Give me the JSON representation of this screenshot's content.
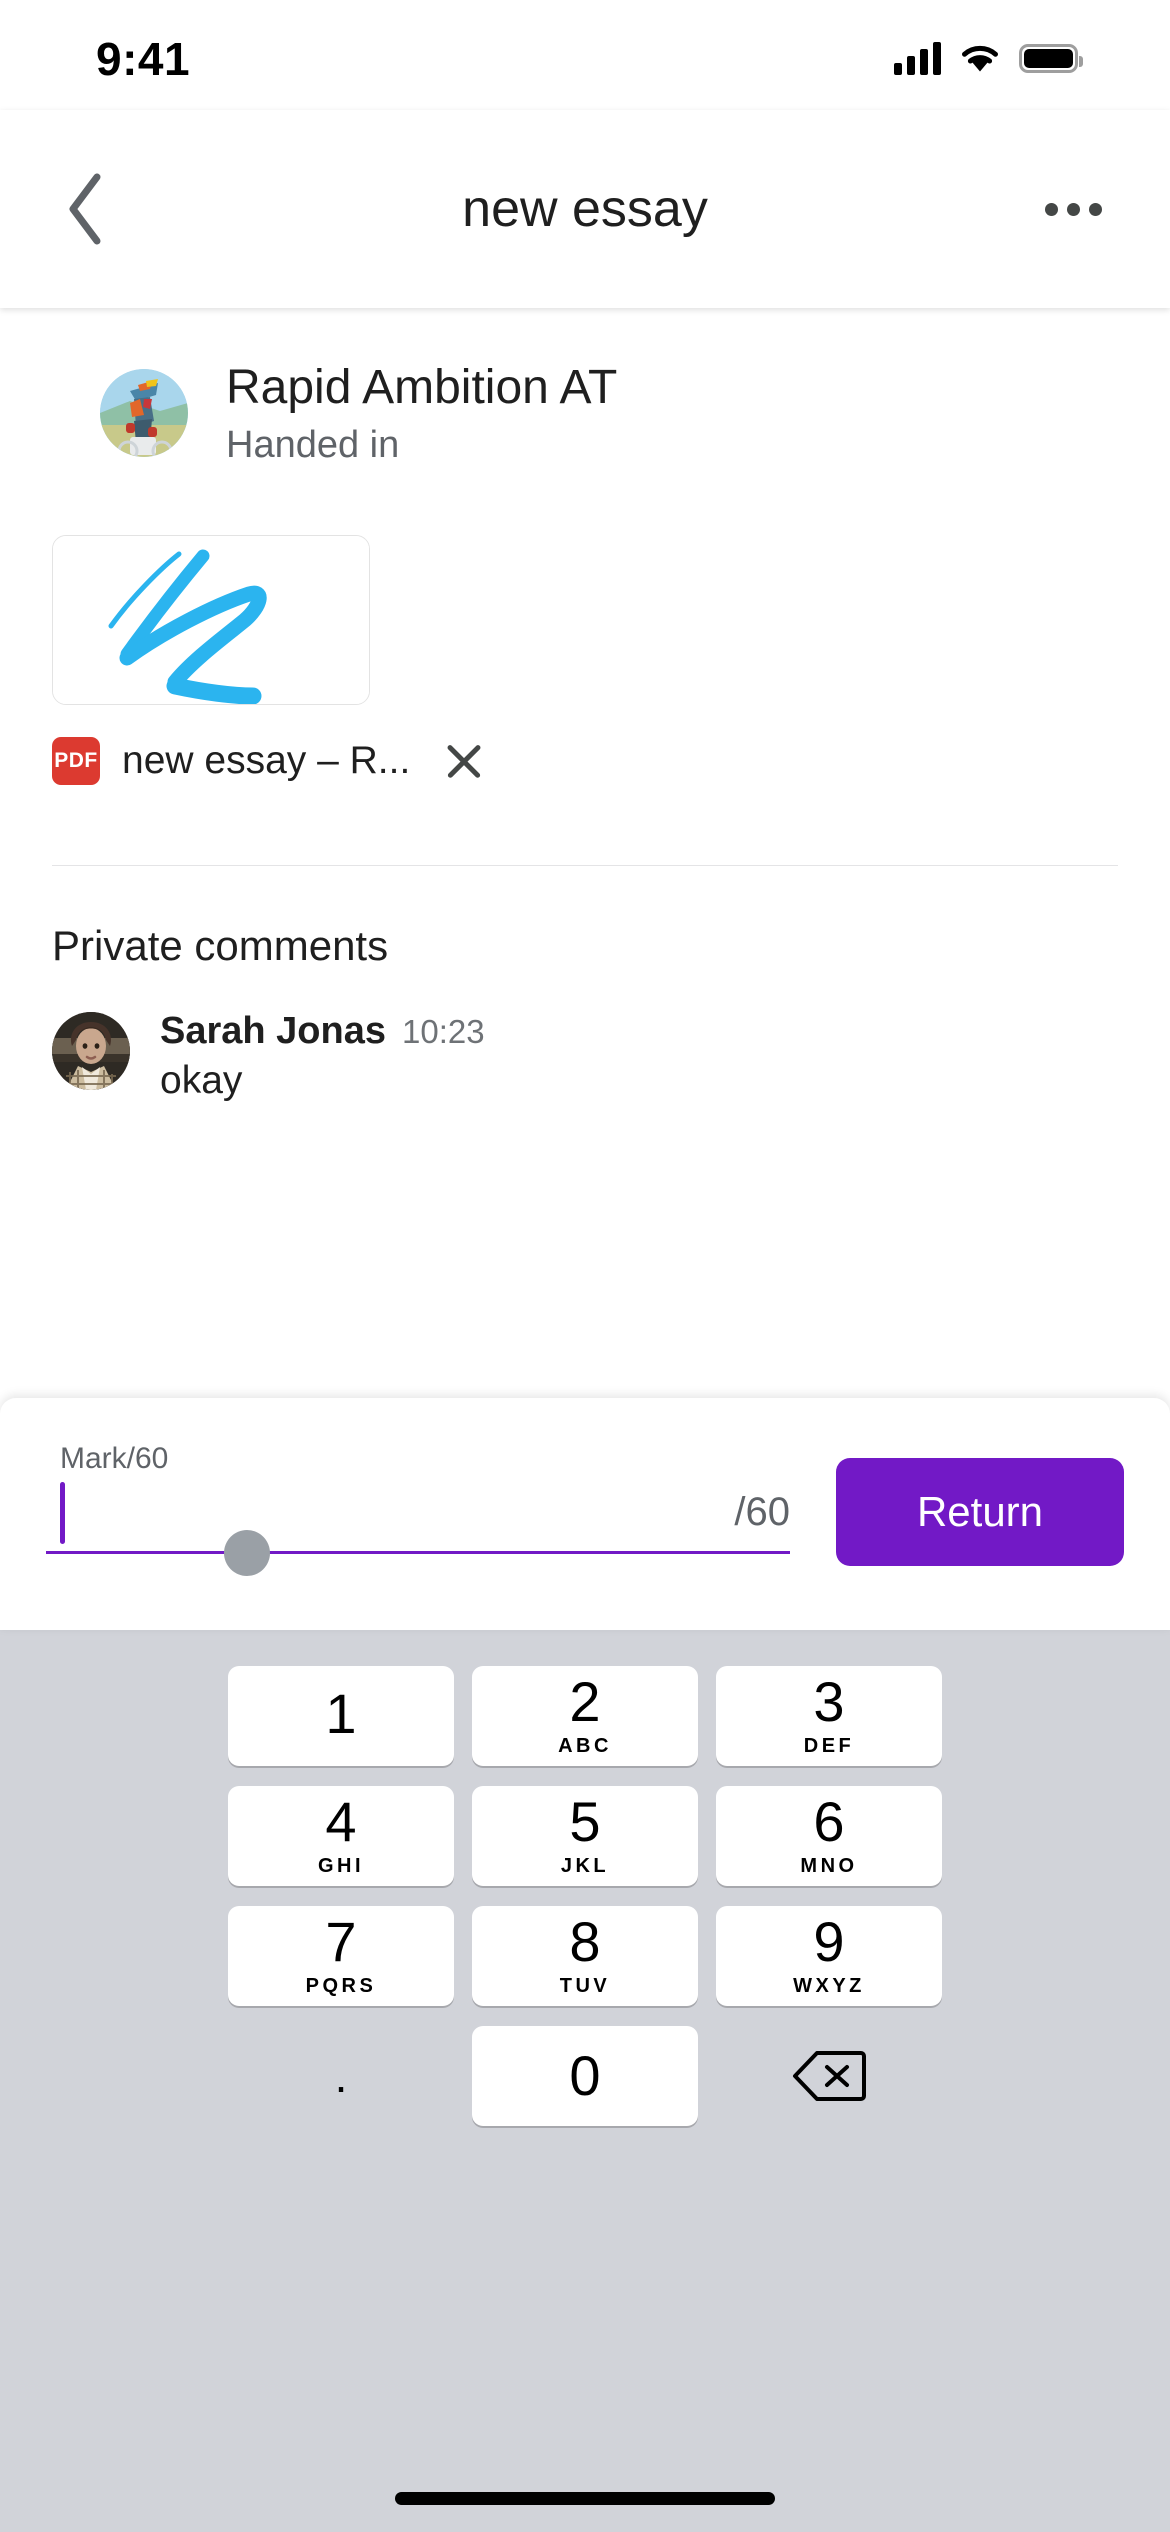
{
  "status_bar": {
    "time": "9:41",
    "cellular_icon": "signal-bars-icon",
    "wifi_icon": "wifi-icon",
    "battery_icon": "battery-full-icon"
  },
  "nav_bar": {
    "back_icon": "chevron-left-icon",
    "title": "new essay",
    "more_icon": "overflow-menu-icon"
  },
  "assignment": {
    "avatar_icon": "student-avatar",
    "student_name": "Rapid Ambition AT",
    "status": "Handed in"
  },
  "attachment": {
    "thumbnail_icon": "pdf-page-thumbnail",
    "file_type_badge": "PDF",
    "file_name": "new essay – R...",
    "remove_icon": "close-icon"
  },
  "comments": {
    "section_title": "Private comments",
    "items": [
      {
        "avatar_icon": "commenter-avatar",
        "author": "Sarah Jonas",
        "time": "10:23",
        "text": "okay"
      }
    ]
  },
  "grading": {
    "mark_label": "Mark/60",
    "mark_value": "",
    "mark_suffix": "/60",
    "return_label": "Return",
    "accent_color": "#7219c6",
    "handle_icon": "slider-handle"
  },
  "keyboard": {
    "keys": [
      {
        "digit": "1",
        "letters": ""
      },
      {
        "digit": "2",
        "letters": "ABC"
      },
      {
        "digit": "3",
        "letters": "DEF"
      },
      {
        "digit": "4",
        "letters": "GHI"
      },
      {
        "digit": "5",
        "letters": "JKL"
      },
      {
        "digit": "6",
        "letters": "MNO"
      },
      {
        "digit": "7",
        "letters": "PQRS"
      },
      {
        "digit": "8",
        "letters": "TUV"
      },
      {
        "digit": "9",
        "letters": "WXYZ"
      },
      {
        "digit": ".",
        "letters": ""
      },
      {
        "digit": "0",
        "letters": ""
      },
      {
        "digit": "",
        "letters": "",
        "icon": "backspace-icon"
      }
    ]
  },
  "home_indicator": "home-indicator"
}
